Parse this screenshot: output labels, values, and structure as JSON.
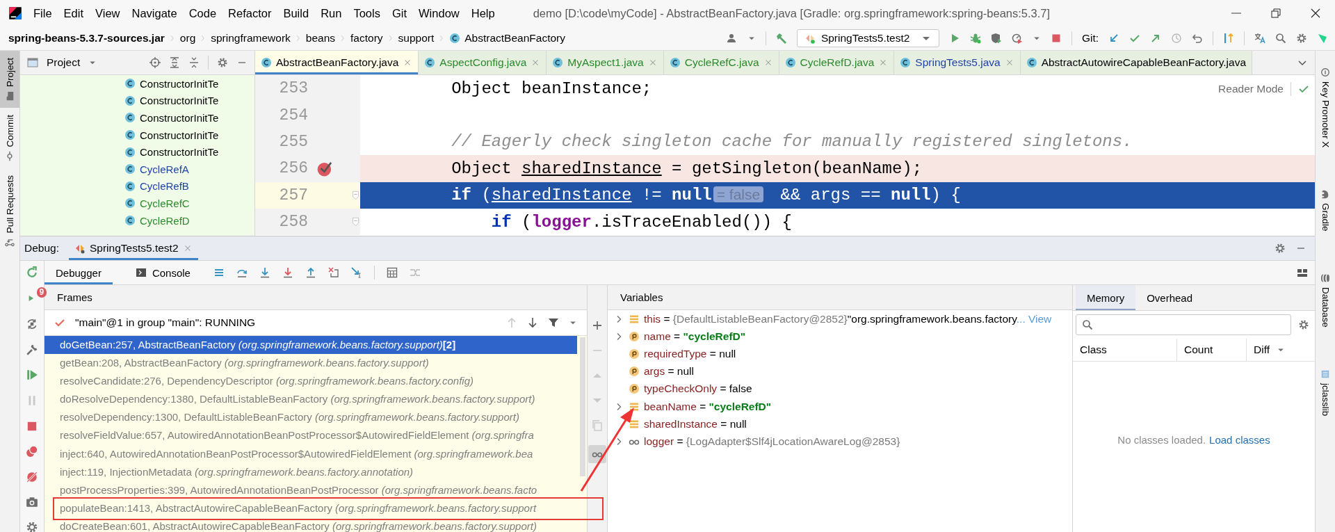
{
  "menu": [
    "File",
    "Edit",
    "View",
    "Navigate",
    "Code",
    "Refactor",
    "Build",
    "Run",
    "Tools",
    "Git",
    "Window",
    "Help"
  ],
  "window_title": "demo [D:\\code\\myCode] - AbstractBeanFactory.java [Gradle: org.springframework:spring-beans:5.3.7]",
  "breadcrumb": [
    "spring-beans-5.3.7-sources.jar",
    "org",
    "springframework",
    "beans",
    "factory",
    "support",
    "AbstractBeanFactory"
  ],
  "run_configuration": "SpringTests5.test2",
  "git_label": "Git:",
  "left_stripe": [
    {
      "label": "Project",
      "selected": true
    },
    {
      "label": "Commit",
      "selected": false
    },
    {
      "label": "Pull Requests",
      "selected": false
    }
  ],
  "right_stripe": [
    "Key Promoter X",
    "Gradle",
    "Database",
    "jclasslib"
  ],
  "project_panel": {
    "title": "Project",
    "items": [
      {
        "label": "ConstructorInitTe",
        "color": "#000000"
      },
      {
        "label": "ConstructorInitTe",
        "color": "#000000"
      },
      {
        "label": "ConstructorInitTe",
        "color": "#000000"
      },
      {
        "label": "ConstructorInitTe",
        "color": "#000000"
      },
      {
        "label": "ConstructorInitTe",
        "color": "#000000"
      },
      {
        "label": "CycleRefA",
        "color": "#2044a8"
      },
      {
        "label": "CycleRefB",
        "color": "#2044a8"
      },
      {
        "label": "CycleRefC",
        "color": "#2b8a2b"
      },
      {
        "label": "CycleRefD",
        "color": "#2b8a2b"
      }
    ]
  },
  "editor_tabs": [
    {
      "label": "AbstractBeanFactory.java",
      "selected": true,
      "color": "#000000",
      "closable": true
    },
    {
      "label": "AspectConfig.java",
      "selected": false,
      "color": "#2b8a2b",
      "closable": true
    },
    {
      "label": "MyAspect1.java",
      "selected": false,
      "color": "#2b8a2b",
      "closable": true
    },
    {
      "label": "CycleRefC.java",
      "selected": false,
      "color": "#2b8a2b",
      "closable": true
    },
    {
      "label": "CycleRefD.java",
      "selected": false,
      "color": "#2b8a2b",
      "closable": true
    },
    {
      "label": "SpringTests5.java",
      "selected": false,
      "color": "#2044a8",
      "closable": true
    },
    {
      "label": "AbstractAutowireCapableBeanFactory.java",
      "selected": false,
      "color": "#000000",
      "closable": false
    }
  ],
  "reader_mode": "Reader Mode",
  "code_lines": [
    {
      "number": "253",
      "breakpoint": false,
      "current": false,
      "segments": [
        {
          "kind": "plain",
          "text": "        Object beanInstance;"
        }
      ]
    },
    {
      "number": "254",
      "breakpoint": false,
      "current": false
    },
    {
      "number": "255",
      "breakpoint": false,
      "current": false,
      "segments": [
        {
          "kind": "comment",
          "text": "        // Eagerly check singleton cache for manually registered singletons."
        }
      ]
    },
    {
      "number": "256",
      "breakpoint": true,
      "current": false,
      "segments": [
        {
          "kind": "plain",
          "text": "        Object "
        },
        {
          "kind": "underlined",
          "text": "sharedInstance"
        },
        {
          "kind": "plain",
          "text": " = getSingleton(beanName);"
        }
      ]
    },
    {
      "number": "257",
      "breakpoint": false,
      "current": true,
      "segments": [
        {
          "kind": "keyword",
          "text": "        if"
        },
        {
          "kind": "plain",
          "text": " ("
        },
        {
          "kind": "underlined",
          "text": "sharedInstance"
        },
        {
          "kind": "plain",
          "text": " != "
        },
        {
          "kind": "keyword",
          "text": "null"
        },
        {
          "kind": "hint",
          "text": "= false"
        },
        {
          "kind": "plain",
          "text": " && args == "
        },
        {
          "kind": "keyword",
          "text": "null"
        },
        {
          "kind": "plain",
          "text": ") {"
        }
      ]
    },
    {
      "number": "258",
      "breakpoint": false,
      "current": false,
      "segments": [
        {
          "kind": "keyword",
          "text": "            if"
        },
        {
          "kind": "plain",
          "text": " ("
        },
        {
          "kind": "field",
          "text": "logger"
        },
        {
          "kind": "plain",
          "text": ".isTraceEnabled()) {"
        }
      ]
    }
  ],
  "debug": {
    "title": "Debug:",
    "session": "SpringTests5.test2",
    "badge": "9",
    "tabs": [
      {
        "label": "Debugger",
        "selected": true
      },
      {
        "label": "Console",
        "selected": false
      }
    ]
  },
  "frames": {
    "title": "Frames",
    "thread": "\"main\"@1 in group \"main\": RUNNING",
    "items": [
      {
        "method": "doGetBean:257, AbstractBeanFactory",
        "package": "(org.springframework.beans.factory.support)",
        "count": "[2]",
        "selected": true
      },
      {
        "method": "getBean:208, AbstractBeanFactory",
        "package": "(org.springframework.beans.factory.support)",
        "selected": false
      },
      {
        "method": "resolveCandidate:276, DependencyDescriptor",
        "package": "(org.springframework.beans.factory.config)",
        "selected": false
      },
      {
        "method": "doResolveDependency:1380, DefaultListableBeanFactory",
        "package": "(org.springframework.beans.factory.support)",
        "selected": false
      },
      {
        "method": "resolveDependency:1300, DefaultListableBeanFactory",
        "package": "(org.springframework.beans.factory.support)",
        "selected": false
      },
      {
        "method": "resolveFieldValue:657, AutowiredAnnotationBeanPostProcessor$AutowiredFieldElement",
        "package": "(org.springfra",
        "selected": false
      },
      {
        "method": "inject:640, AutowiredAnnotationBeanPostProcessor$AutowiredFieldElement",
        "package": "(org.springframework.bea",
        "selected": false
      },
      {
        "method": "inject:119, InjectionMetadata",
        "package": "(org.springframework.beans.factory.annotation)",
        "selected": false
      },
      {
        "method": "postProcessProperties:399, AutowiredAnnotationBeanPostProcessor",
        "package": "(org.springframework.beans.facto",
        "selected": false
      },
      {
        "method": "populateBean:1413, AbstractAutowireCapableBeanFactory",
        "package": "(org.springframework.beans.factory.support",
        "selected": false
      },
      {
        "method": "doCreateBean:601, AbstractAutowireCapableBeanFactory",
        "package": "(org.springframework.beans.factory.support)",
        "selected": false
      }
    ]
  },
  "variables": {
    "title": "Variables",
    "items": [
      {
        "kind": "field",
        "expandable": true,
        "name": "this",
        "operator": "=",
        "type": "{DefaultListableBeanFactory@2852}",
        "value": "\"org.springframework.beans.factory",
        "string": false,
        "link": "... View"
      },
      {
        "kind": "param",
        "expandable": true,
        "name": "name",
        "operator": "=",
        "value": "\"cycleRefD\"",
        "string": true
      },
      {
        "kind": "param",
        "expandable": false,
        "name": "requiredType",
        "operator": "=",
        "value": "null",
        "string": false
      },
      {
        "kind": "param",
        "expandable": false,
        "name": "args",
        "operator": "=",
        "value": "null",
        "string": false
      },
      {
        "kind": "param",
        "expandable": false,
        "name": "typeCheckOnly",
        "operator": "=",
        "value": "false",
        "string": false
      },
      {
        "kind": "field",
        "expandable": true,
        "name": "beanName",
        "operator": "=",
        "value": "\"cycleRefD\"",
        "string": true
      },
      {
        "kind": "field",
        "expandable": false,
        "name": "sharedInstance",
        "operator": "=",
        "value": "null",
        "string": false
      },
      {
        "kind": "watch",
        "expandable": true,
        "name": "logger",
        "operator": "=",
        "type": "{LogAdapter$Slf4jLocationAwareLog@2853}"
      }
    ]
  },
  "memory": {
    "tabs": [
      {
        "label": "Memory",
        "selected": true
      },
      {
        "label": "Overhead",
        "selected": false
      }
    ],
    "columns": [
      "Class",
      "Count",
      "Diff"
    ],
    "empty_message": "No classes loaded.",
    "empty_link": "Load classes"
  }
}
